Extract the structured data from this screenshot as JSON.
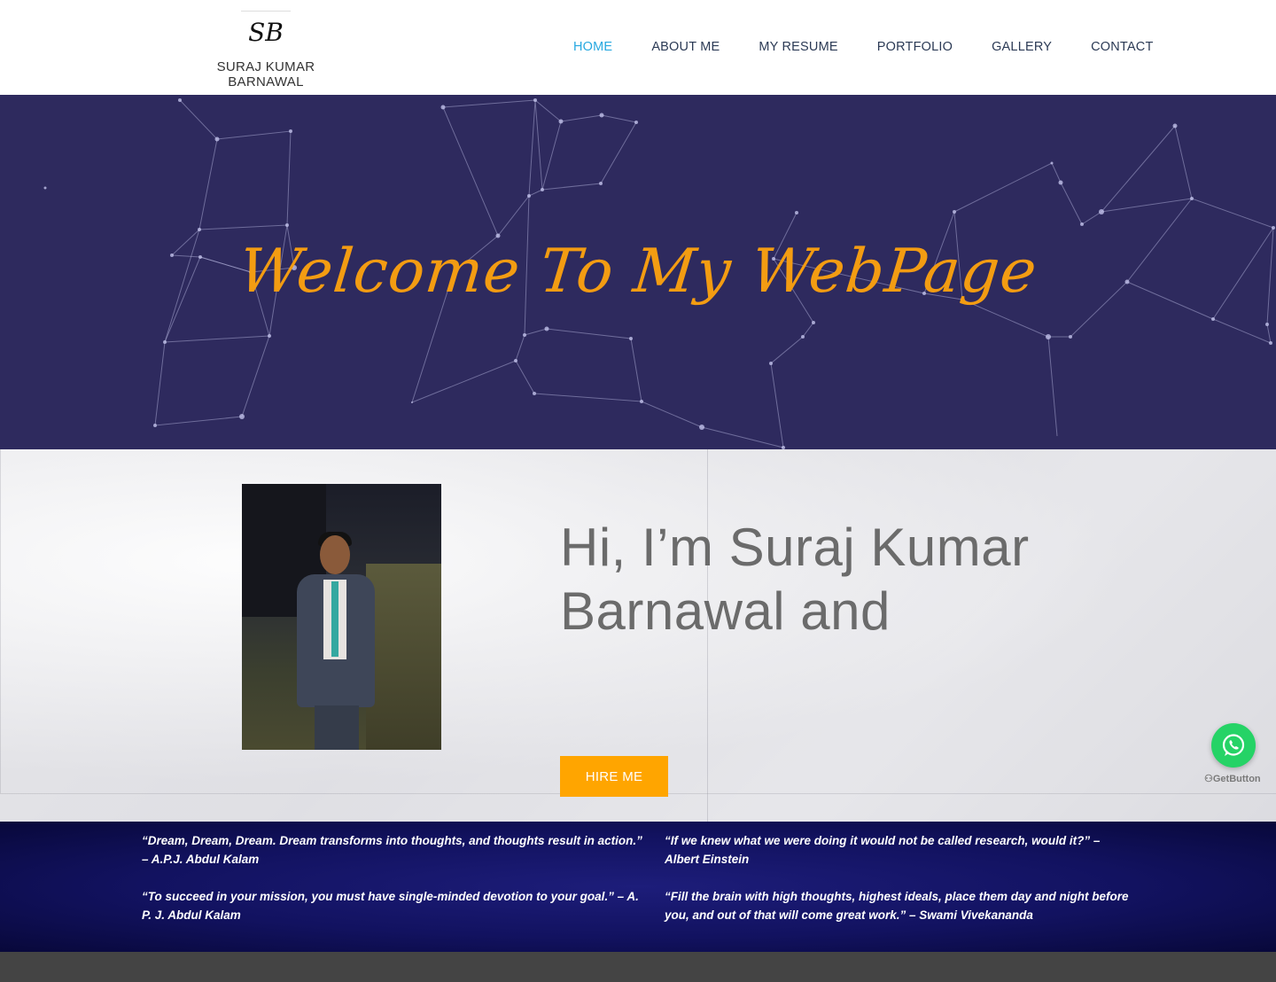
{
  "header": {
    "logo_mark": "SB",
    "site_name": "SURAJ KUMAR BARNAWAL",
    "nav": [
      {
        "label": "HOME",
        "active": true
      },
      {
        "label": "ABOUT ME",
        "active": false
      },
      {
        "label": "MY RESUME",
        "active": false
      },
      {
        "label": "PORTFOLIO",
        "active": false
      },
      {
        "label": "GALLERY",
        "active": false
      },
      {
        "label": "CONTACT",
        "active": false
      }
    ]
  },
  "hero": {
    "title": "Welcome To My WebPage",
    "background_color": "#2e2a5e",
    "title_color": "#f39c12"
  },
  "about": {
    "intro": "Hi, I’m Suraj Kumar Barnawal and",
    "hire_button": "HIRE ME",
    "hire_color": "#ffa500"
  },
  "quotes": [
    "“Dream, Dream, Dream. Dream transforms into thoughts, and thoughts result in action.”  – A.P.J. Abdul Kalam",
    "“If we knew what we were doing it would not be called research, would it?” – Albert Einstein",
    "“To succeed in your mission, you must have single-minded devotion to your goal.” – A. P. J. Abdul Kalam",
    "“Fill the brain with high thoughts, highest ideals, place them day and night before you, and out of that will come great work.” – Swami Vivekananda"
  ],
  "widgets": {
    "whatsapp_icon": "whatsapp-icon",
    "getbutton_label": "GetButton"
  },
  "nav_active_color": "#27a8e0"
}
